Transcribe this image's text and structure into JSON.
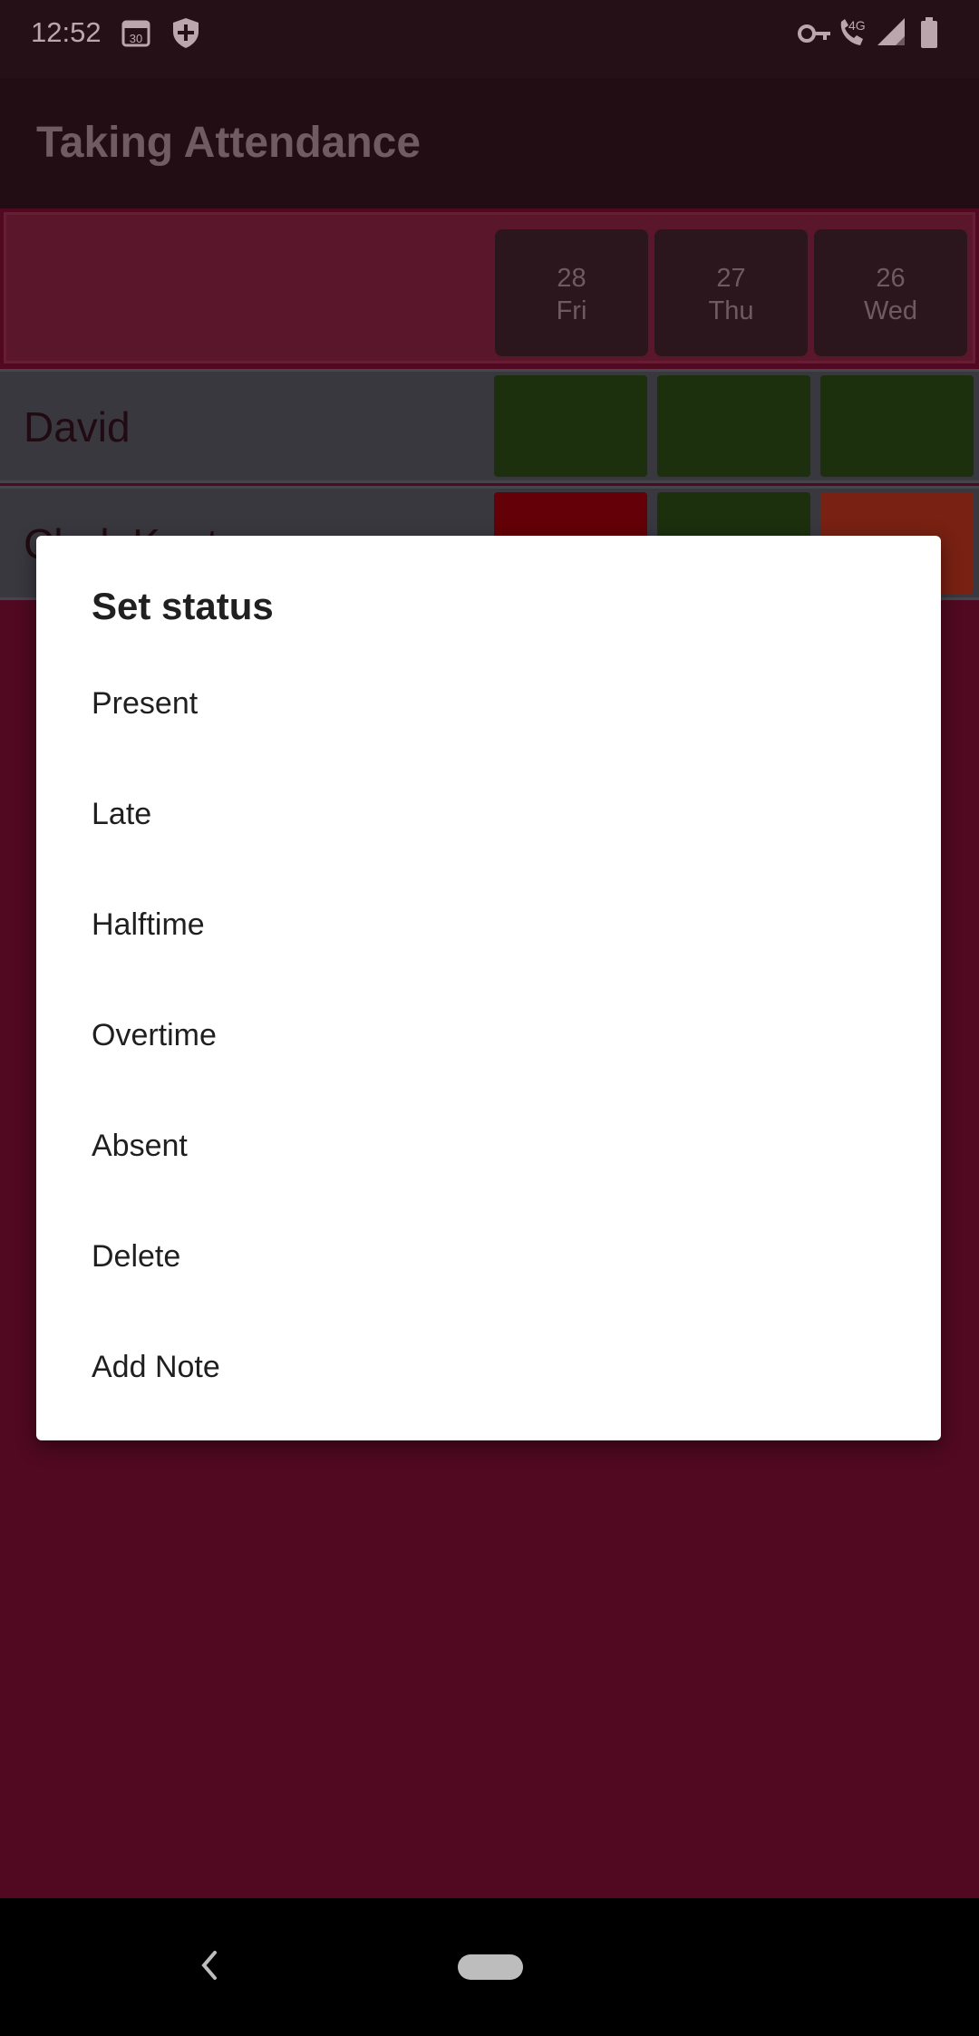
{
  "status_bar": {
    "time": "12:52",
    "calendar_date": "30",
    "icons": [
      "calendar-icon",
      "shield-icon",
      "vpn-key-icon",
      "wifi-calling-icon",
      "signal-icon",
      "battery-icon"
    ],
    "network_label": "4G"
  },
  "app_bar": {
    "title": "Taking Attendance"
  },
  "dates": [
    {
      "day": "28",
      "weekday": "Fri"
    },
    {
      "day": "27",
      "weekday": "Thu"
    },
    {
      "day": "26",
      "weekday": "Wed"
    }
  ],
  "rows": [
    {
      "name": "David",
      "statuses": [
        "#0b4a0b",
        "#0b4a0b",
        "#0b4a0b"
      ]
    },
    {
      "name": "Clark Kent",
      "statuses": [
        "#7a0000",
        "#0b4a0b",
        "#9a3412"
      ]
    }
  ],
  "dialog": {
    "title": "Set status",
    "options": [
      "Present",
      "Late",
      "Halftime",
      "Overtime",
      "Absent",
      "Delete",
      "Add Note"
    ]
  },
  "colors": {
    "background": "#5b0e27",
    "present": "#0b4a0b",
    "absent": "#7a0000",
    "late": "#9a3412",
    "row": "#395656"
  }
}
